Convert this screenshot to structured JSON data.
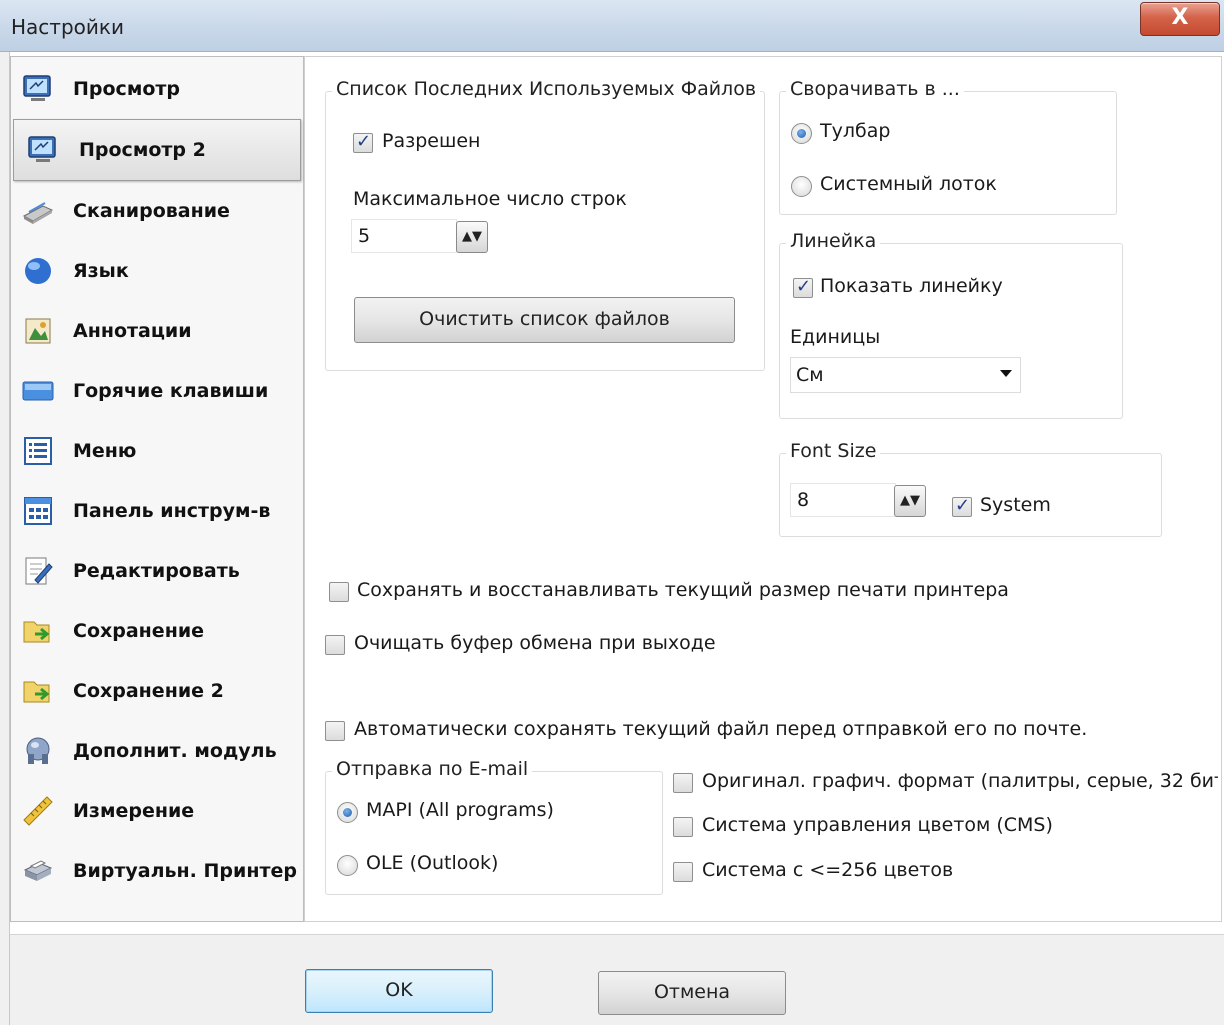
{
  "window": {
    "title": "Настройки",
    "close_symbol": "X"
  },
  "sidebar": {
    "items": [
      {
        "label": "Просмотр",
        "icon": "monitor-icon"
      },
      {
        "label": "Просмотр 2",
        "icon": "monitor-icon",
        "selected": true
      },
      {
        "label": "Сканирование",
        "icon": "scanner-icon"
      },
      {
        "label": "Язык",
        "icon": "globe-icon"
      },
      {
        "label": "Аннотации",
        "icon": "annotation-icon"
      },
      {
        "label": "Горячие клавиши",
        "icon": "keyboard-icon"
      },
      {
        "label": "Меню",
        "icon": "menu-icon"
      },
      {
        "label": "Панель инструм-в",
        "icon": "toolbar-icon"
      },
      {
        "label": "Редактировать",
        "icon": "edit-icon"
      },
      {
        "label": "Сохранение",
        "icon": "save-folder-icon"
      },
      {
        "label": "Сохранение 2",
        "icon": "save-folder-icon"
      },
      {
        "label": "Дополнит. модуль",
        "icon": "plugin-icon"
      },
      {
        "label": "Измерение",
        "icon": "ruler-icon"
      },
      {
        "label": "Виртуальн. Принтер",
        "icon": "printer-icon"
      }
    ]
  },
  "recent_files": {
    "title": "Список Последних Используемых Файлов",
    "enabled_label": "Разрешен",
    "enabled": true,
    "max_rows_label": "Максимальное число строк",
    "max_rows_value": "5",
    "clear_button": "Очистить список файлов"
  },
  "minimize_to": {
    "title": "Сворачивать в ...",
    "options": [
      {
        "label": "Тулбар",
        "checked": true
      },
      {
        "label": "Системный лоток",
        "checked": false
      }
    ]
  },
  "ruler": {
    "title": "Линейка",
    "show_label": "Показать линейку",
    "show": true,
    "units_label": "Единицы",
    "units_value": "См"
  },
  "font_size": {
    "title": "Font Size",
    "value": "8",
    "system_label": "System",
    "system": true
  },
  "options": {
    "save_print_size": "Сохранять и восстанавливать текущий размер печати принтера",
    "clear_clipboard": "Очищать буфер обмена при выходе",
    "autosave_before_email": "Автоматически сохранять текущий файл перед отправкой его по почте."
  },
  "email": {
    "title": "Отправка по E-mail",
    "options": [
      {
        "label": "MAPI (All programs)",
        "checked": true
      },
      {
        "label": "OLE (Outlook)",
        "checked": false
      }
    ]
  },
  "email_options": {
    "original_format": "Оригинал. графич. формат (палитры, серые, 32 бит",
    "cms": "Система управления цветом (CMS)",
    "colors_256": "Система с <=256 цветов"
  },
  "buttons": {
    "ok": "OK",
    "cancel": "Отмена"
  },
  "colors": {
    "titlebar": "#c9d8ea",
    "close": "#c44a2f",
    "check": "#1f3f86",
    "radio": "#1b5db0"
  }
}
